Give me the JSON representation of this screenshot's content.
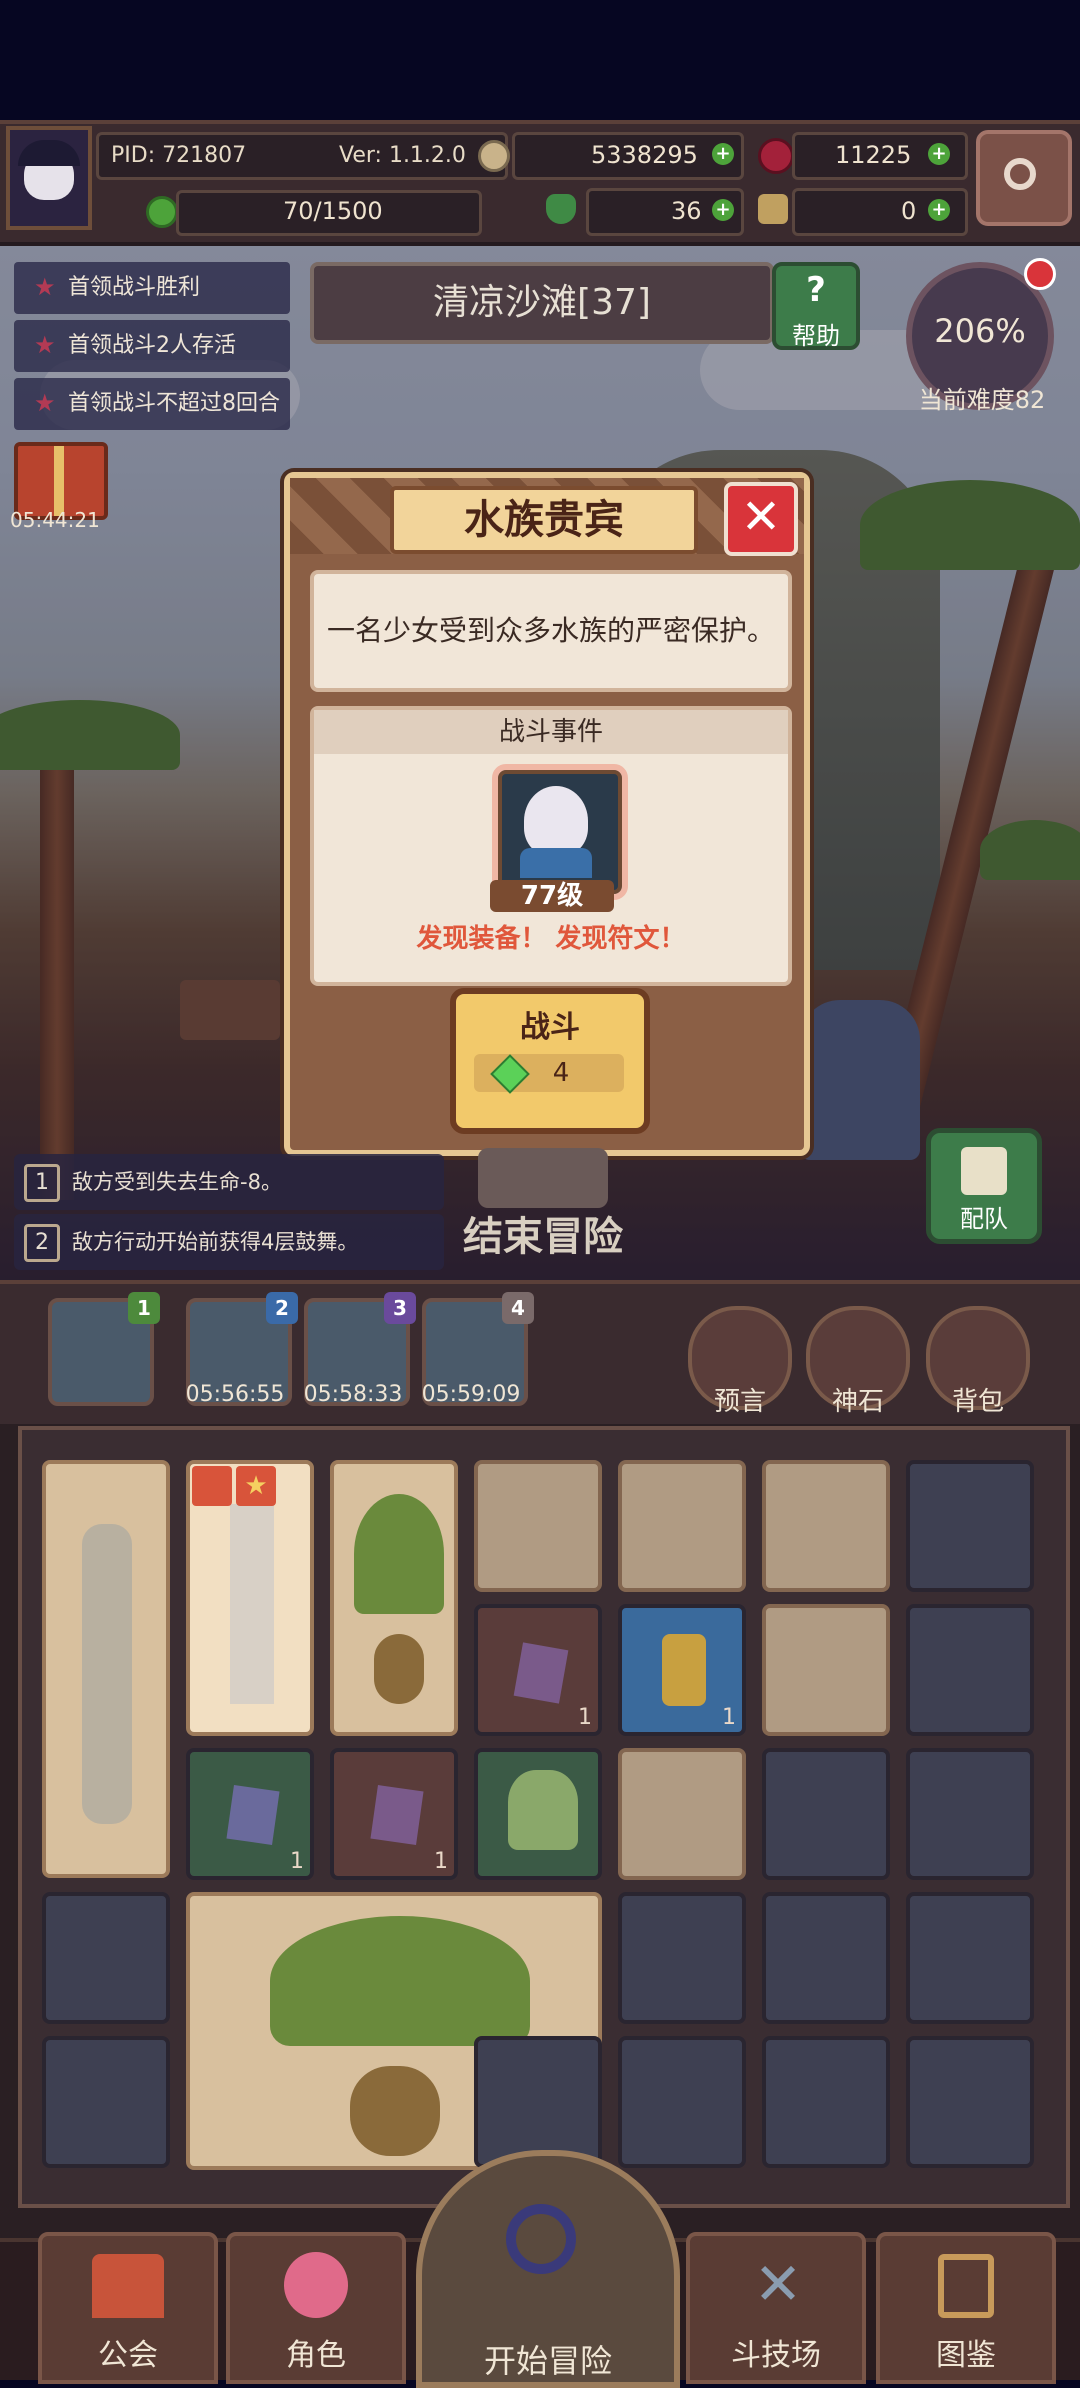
{
  "header": {
    "pid": "PID: 721807",
    "version": "Ver: 1.1.2.0",
    "gold": "5338295",
    "gems": "11225",
    "energy": "70/1500",
    "clover": "36",
    "keys": "0"
  },
  "quests": [
    "首领战斗胜利",
    "首领战斗2人存活",
    "首领战斗不超过8回合"
  ],
  "gift_timer": "05:44:21",
  "level": {
    "name": "清凉沙滩[37]",
    "help_label": "帮助"
  },
  "difficulty": {
    "percent": "206%",
    "label": "当前难度82"
  },
  "dialog": {
    "title": "水族贵宾",
    "description": "一名少女受到众多水族的严密保护。",
    "event_header": "战斗事件",
    "enemy_level": "77级",
    "find_text": "发现装备！ 发现符文！",
    "fight_label": "战斗",
    "fight_cost": "4"
  },
  "hints": [
    {
      "num": "1",
      "text": "敌方受到失去生命-8。"
    },
    {
      "num": "2",
      "text": "敌方行动开始前获得4层鼓舞。"
    }
  ],
  "end_adventure": "结束冒险",
  "team_label": "配队",
  "slots": [
    {
      "num": "1",
      "time": ""
    },
    {
      "num": "2",
      "time": "05:56:55"
    },
    {
      "num": "3",
      "time": "05:58:33"
    },
    {
      "num": "4",
      "time": "05:59:09"
    }
  ],
  "right_buttons": [
    "预言",
    "神石",
    "背包"
  ],
  "grid_counts": [
    "1",
    "1",
    "1",
    "1"
  ],
  "nav": [
    "公会",
    "角色",
    "开始冒险",
    "斗技场",
    "图鉴"
  ],
  "colors": {
    "accent": "#f2c96b",
    "danger": "#d9343a",
    "find": "#e0573b",
    "gem": "#5bd158"
  }
}
